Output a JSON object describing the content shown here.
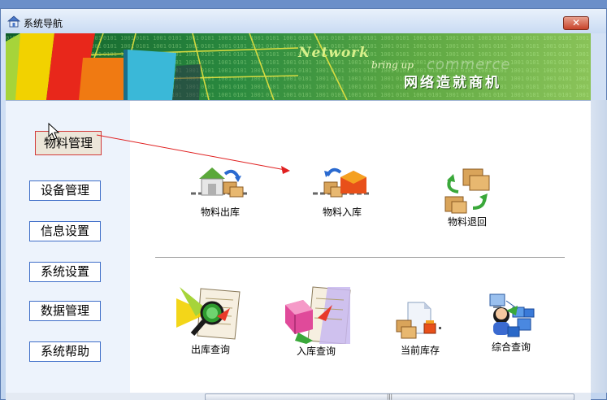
{
  "window": {
    "title": "系统导航"
  },
  "banner": {
    "network": "Network",
    "subtitle": "bring up",
    "commerce": "commerce",
    "slogan": "网络造就商机"
  },
  "sidebar": {
    "items": [
      {
        "label": "物料管理",
        "active": true
      },
      {
        "label": "设备管理"
      },
      {
        "label": "信息设置"
      },
      {
        "label": "系统设置"
      },
      {
        "label": "数据管理"
      },
      {
        "label": "系统帮助"
      }
    ]
  },
  "operations": {
    "items": [
      {
        "label": "物料出库",
        "icon": "warehouse-out-icon"
      },
      {
        "label": "物料入库",
        "icon": "warehouse-in-icon"
      },
      {
        "label": "物料退回",
        "icon": "return-boxes-icon"
      }
    ]
  },
  "queries": {
    "items": [
      {
        "label": "出库查询",
        "icon": "search-out-icon"
      },
      {
        "label": "入库查询",
        "icon": "search-in-icon"
      },
      {
        "label": "当前库存",
        "icon": "inventory-icon"
      },
      {
        "label": "综合查询",
        "icon": "network-query-icon"
      }
    ]
  },
  "colors": {
    "active_border": "#d23a3a",
    "button_border": "#3f6ec8",
    "arrow": "#e02020"
  }
}
